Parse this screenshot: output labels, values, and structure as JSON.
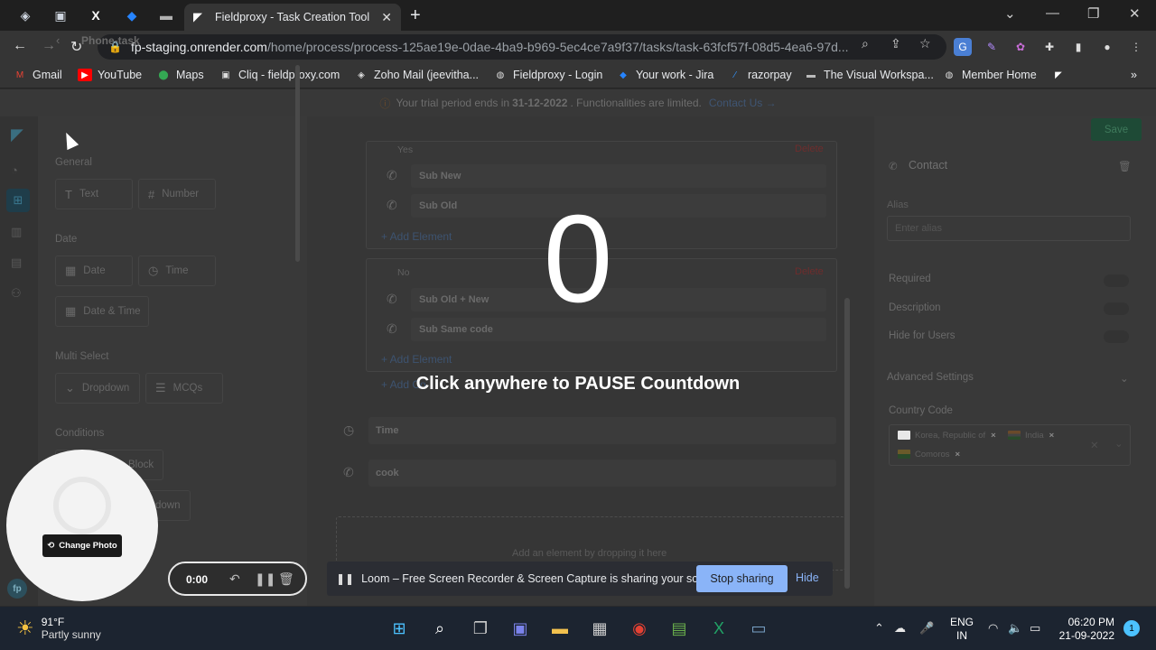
{
  "browser": {
    "active_tab_title": "Fieldproxy - Task Creation Tool",
    "url_host": "fp-staging.onrender.com",
    "url_path": "/home/process/process-125ae19e-0dae-4ba9-b969-5ec4ce7a9f37/tasks/task-63fcf57f-08d5-4ea6-97d...",
    "bookmarks": [
      "Gmail",
      "YouTube",
      "Maps",
      "Cliq - fieldproxy.com",
      "Zoho Mail (jeevitha...",
      "Fieldproxy - Login",
      "Your work - Jira",
      "razorpay",
      "The Visual Workspa...",
      "Member Home"
    ]
  },
  "trial": {
    "prefix": "Your trial period ends in",
    "date": "31-12-2022",
    "suffix": ". Functionalities are limited.",
    "contact": "Contact Us →"
  },
  "palette": {
    "title": "Phone-task",
    "sections": {
      "general": "General",
      "date": "Date",
      "multi": "Multi Select",
      "conditions": "Conditions"
    },
    "items": {
      "text": "Text",
      "number": "Number",
      "date": "Date",
      "time": "Time",
      "datetime": "Date & Time",
      "dropdown": "Dropdown",
      "mcqs": "MCQs",
      "block": "Block",
      "down": "down"
    }
  },
  "canvas": {
    "yes_label": "Yes",
    "no_label": "No",
    "delete": "Delete",
    "yes_rows": [
      "Sub New",
      "Sub Old"
    ],
    "no_rows": [
      "Sub Old + New",
      "Sub Same code"
    ],
    "add_element": "+ Add Element",
    "add_co": "+ Add Co",
    "fields": [
      "Time",
      "cook"
    ],
    "drop_hint": "Add an element by dropping it here"
  },
  "props": {
    "save": "Save",
    "title": "Contact",
    "alias_label": "Alias",
    "alias_placeholder": "Enter alias",
    "required": "Required",
    "description": "Description",
    "hide_users": "Hide for Users",
    "advanced": "Advanced Settings",
    "country_code": "Country Code",
    "countries": [
      "Korea, Republic of",
      "India",
      "Comoros"
    ]
  },
  "overlay": {
    "countdown": "0",
    "message": "Click anywhere to PAUSE Countdown"
  },
  "loom": {
    "change_photo": "Change Photo",
    "timer": "0:00",
    "share_message": "Loom – Free Screen Recorder & Screen Capture is sharing your screen.",
    "stop": "Stop sharing",
    "hide": "Hide",
    "badge": "fp"
  },
  "taskbar": {
    "temp": "91°F",
    "condition": "Partly sunny",
    "lang1": "ENG",
    "lang2": "IN",
    "time": "06:20 PM",
    "date": "21-09-2022",
    "notifications": "1"
  }
}
